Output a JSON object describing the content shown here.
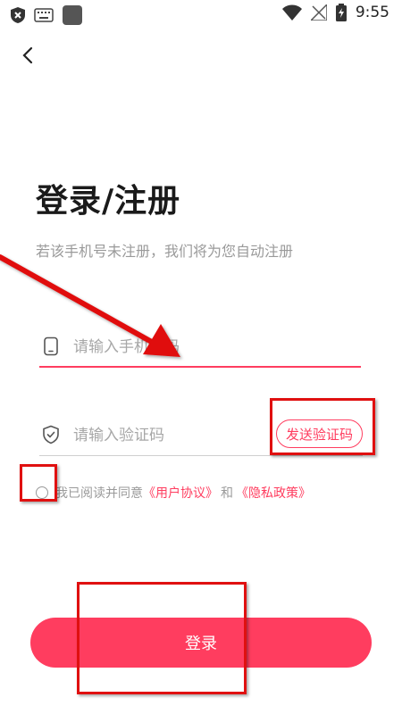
{
  "status_bar": {
    "time": "9:55",
    "left_icons": [
      "shield-x-icon",
      "keyboard-icon",
      "app-square-icon"
    ],
    "right_icons": [
      "wifi-icon",
      "no-signal-icon",
      "battery-charging-icon"
    ]
  },
  "header": {
    "back_icon": "chevron-left-icon"
  },
  "page": {
    "title": "登录/注册",
    "subtitle": "若该手机号未注册，我们将为您自动注册"
  },
  "form": {
    "phone": {
      "placeholder": "请输入手机号码",
      "value": "",
      "icon": "phone-icon"
    },
    "code": {
      "placeholder": "请输入验证码",
      "value": "",
      "icon": "shield-check-icon"
    },
    "send_code_label": "发送验证码"
  },
  "agreement": {
    "prefix": "我已阅读并同意",
    "user_agreement": "《用户协议》",
    "and": "和",
    "privacy_policy": "《隐私政策》",
    "checked": false
  },
  "login_label": "登录",
  "colors": {
    "accent": "#ff3d5f",
    "annotation": "#e01010"
  }
}
